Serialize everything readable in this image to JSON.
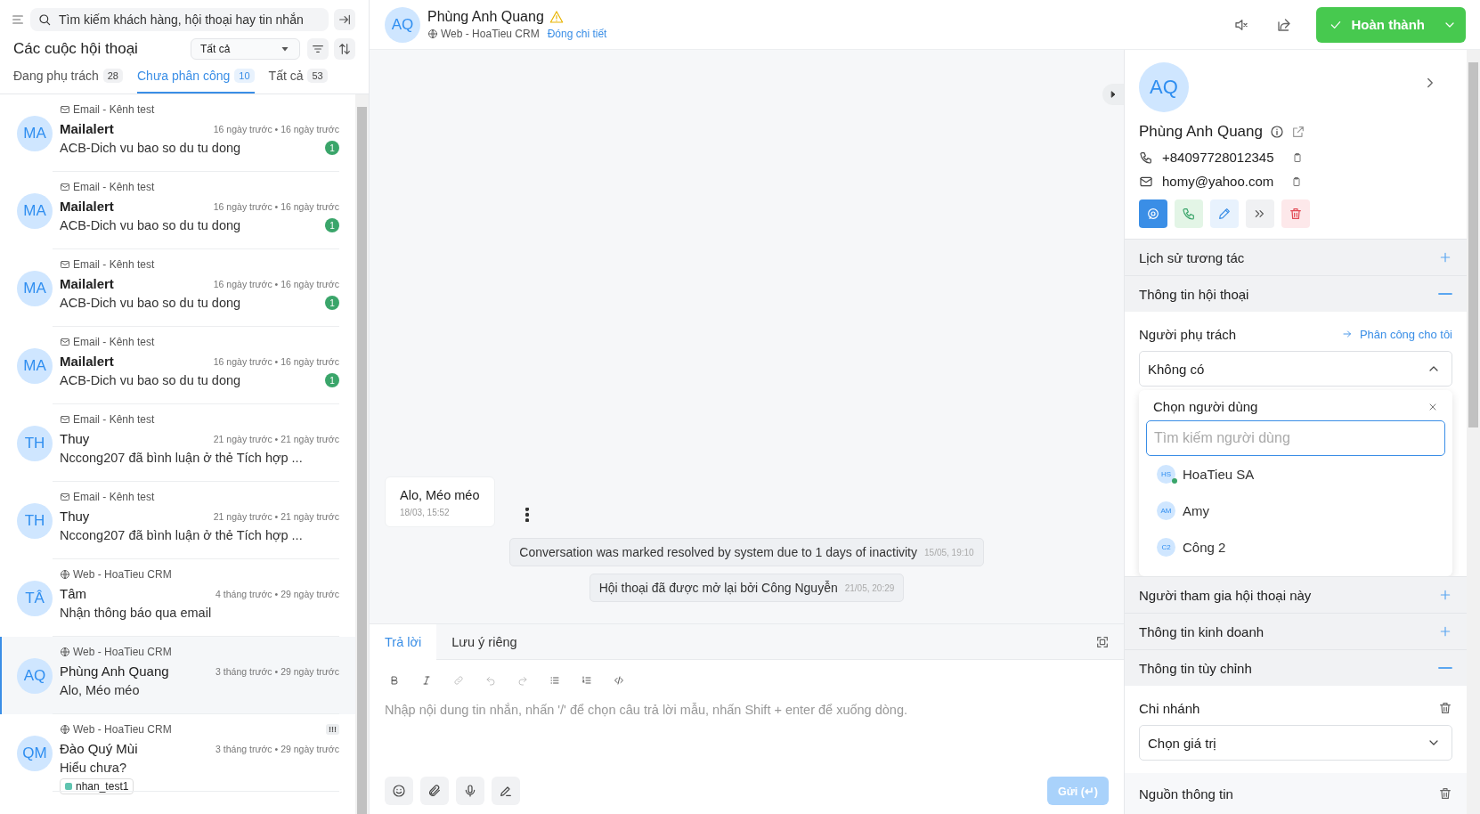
{
  "sidebar": {
    "search": {
      "placeholder": "Tìm kiếm khách hàng, hội thoại hay tin nhắn"
    },
    "title": "Các cuộc hội thoại",
    "filter": {
      "value": "Tất cả"
    },
    "tabs": [
      {
        "label": "Đang phụ trách",
        "count": "28",
        "selected": false
      },
      {
        "label": "Chưa phân công",
        "count": "10",
        "selected": true
      },
      {
        "label": "Tất cả",
        "count": "53",
        "selected": false
      }
    ],
    "conversations": [
      {
        "channel": {
          "kind": "email",
          "label": "Email - Kênh test"
        },
        "avatar": "MA",
        "name": "Mailalert",
        "time": "16 ngày trước • 16 ngày trước",
        "preview": "ACB-Dich vu bao so du tu dong",
        "unread": "1",
        "selected": false
      },
      {
        "channel": {
          "kind": "email",
          "label": "Email - Kênh test"
        },
        "avatar": "MA",
        "name": "Mailalert",
        "time": "16 ngày trước • 16 ngày trước",
        "preview": "ACB-Dich vu bao so du tu dong",
        "unread": "1",
        "selected": false
      },
      {
        "channel": {
          "kind": "email",
          "label": "Email - Kênh test"
        },
        "avatar": "MA",
        "name": "Mailalert",
        "time": "16 ngày trước • 16 ngày trước",
        "preview": "ACB-Dich vu bao so du tu dong",
        "unread": "1",
        "selected": false
      },
      {
        "channel": {
          "kind": "email",
          "label": "Email - Kênh test"
        },
        "avatar": "MA",
        "name": "Mailalert",
        "time": "16 ngày trước • 16 ngày trước",
        "preview": "ACB-Dich vu bao so du tu dong",
        "unread": "1",
        "selected": false
      },
      {
        "channel": {
          "kind": "email",
          "label": "Email - Kênh test"
        },
        "avatar": "TH",
        "name": "Thuy",
        "time": "21 ngày trước • 21 ngày trước",
        "preview": "Nccong207 đã bình luận ở thẻ Tích hợp ...",
        "selected": false
      },
      {
        "channel": {
          "kind": "email",
          "label": "Email - Kênh test"
        },
        "avatar": "TH",
        "name": "Thuy",
        "time": "21 ngày trước • 21 ngày trước",
        "preview": "Nccong207 đã bình luận ở thẻ Tích hợp ...",
        "selected": false
      },
      {
        "channel": {
          "kind": "web",
          "label": "Web - HoaTieu CRM"
        },
        "avatar": "TÂ",
        "name": "Tâm",
        "time": "4 tháng trước • 29 ngày trước",
        "preview": "Nhận thông báo qua email",
        "selected": false
      },
      {
        "channel": {
          "kind": "web",
          "label": "Web - HoaTieu CRM"
        },
        "avatar": "AQ",
        "name": "Phùng Anh Quang",
        "time": "3 tháng trước • 29 ngày trước",
        "preview": "Alo, Méo méo",
        "selected": true
      },
      {
        "channel": {
          "kind": "web",
          "label": "Web - HoaTieu CRM"
        },
        "avatar": "QM",
        "name": "Đào Quý Mùi",
        "time": "3 tháng trước • 29 ngày trước",
        "preview": "Hiểu chưa?",
        "flag": "!!!",
        "tag": {
          "label": "nhan_test1",
          "color": "#5fc4b0"
        },
        "selected": false
      }
    ]
  },
  "header": {
    "avatar": "AQ",
    "name": "Phùng Anh Quang",
    "warning": true,
    "channel": {
      "kind": "web",
      "label": "Web - HoaTieu CRM"
    },
    "link": "Đóng chi tiết",
    "resolve_button": "Hoàn thành"
  },
  "messages": [
    {
      "kind": "incoming",
      "text": "Alo, Méo méo",
      "time": "18/03, 15:52"
    },
    {
      "kind": "activity",
      "text": "Conversation was marked resolved by system due to 1 days of inactivity",
      "time": "15/05, 19:10"
    },
    {
      "kind": "activity",
      "text": "Hội thoại đã được mở lại bởi Công Nguyễn",
      "time": "21/05, 20:29"
    }
  ],
  "composer": {
    "tabs": [
      {
        "label": "Trả lời",
        "selected": true
      },
      {
        "label": "Lưu ý riêng",
        "selected": false
      }
    ],
    "placeholder": "Nhập nội dung tin nhắn, nhấn '/' để chọn câu trả lời mẫu, nhấn Shift + enter để xuống dòng.",
    "send": {
      "label": "Gửi (↵)",
      "disabled": true
    }
  },
  "contact": {
    "avatar": "AQ",
    "name": "Phùng Anh Quang",
    "phone": "+84097728012345",
    "email": "homy@yahoo.com"
  },
  "sections": [
    {
      "kind": "collapsible",
      "title": "Lịch sử tương tác",
      "expanded": false
    },
    {
      "kind": "assignee",
      "title": "Thông tin hội thoại",
      "expanded": true,
      "label": "Người phụ trách",
      "assign_link": "Phân công cho tôi",
      "value": "Không có",
      "open": true,
      "picker": {
        "title": "Chọn người dùng",
        "placeholder": "Tìm kiếm người dùng",
        "users": [
          {
            "initials": "HS",
            "name": "HoaTieu SA",
            "online": true
          },
          {
            "initials": "AM",
            "name": "Amy",
            "online": false
          },
          {
            "initials": "C2",
            "name": "Công 2",
            "online": false
          }
        ]
      }
    },
    {
      "kind": "collapsible",
      "title": "Người tham gia hội thoại này",
      "expanded": false
    },
    {
      "kind": "collapsible",
      "title": "Thông tin kinh doanh",
      "expanded": false
    },
    {
      "kind": "fields",
      "title": "Thông tin tùy chỉnh",
      "expanded": true,
      "fields": [
        {
          "label": "Chi nhánh",
          "value": "Chọn giá trị"
        },
        {
          "label": "Nguồn thông tin"
        }
      ]
    }
  ]
}
